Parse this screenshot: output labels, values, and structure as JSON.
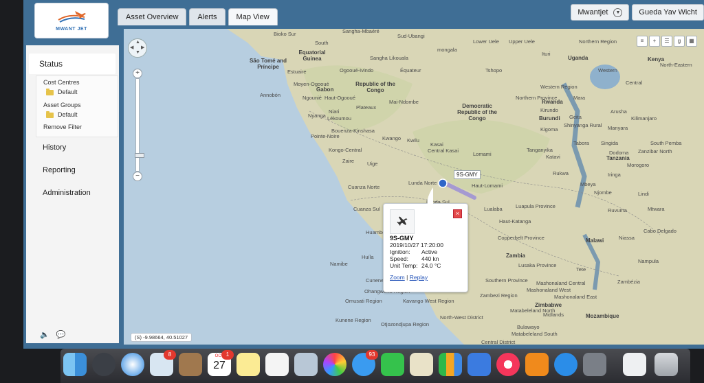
{
  "brand": {
    "logo_text": "MWANT JET"
  },
  "tabs": [
    {
      "label": "Asset Overview"
    },
    {
      "label": "Alerts"
    },
    {
      "label": "Map View"
    }
  ],
  "header": {
    "account_label": "Mwantjet",
    "user_label": "Gueda Yav Wicht"
  },
  "sidebar": {
    "status": "Status",
    "cost_centres": "Cost Centres",
    "default_1": "Default",
    "asset_groups": "Asset Groups",
    "default_2": "Default",
    "remove_filter": "Remove Filter",
    "history": "History",
    "reporting": "Reporting",
    "administration": "Administration"
  },
  "map": {
    "coords": "(S) -9.98664, 40.51027",
    "vehicle_label": "9S-GMY",
    "places": [
      "Bioko Sur",
      "Sangha-Mbaéré",
      "Sud-Ubangi",
      "Lower Uele",
      "Upper Uele",
      "Northern Region",
      "South",
      "Equatorial Guinea",
      "São Tomé and Príncipe",
      "Estuaire",
      "Sangha",
      "Likouala",
      "mongala",
      "Tshopo",
      "Ituri",
      "Uganda",
      "Kenya",
      "North-Eastern",
      "Western",
      "Moyen-Ogooué",
      "Gabon",
      "Ogooué-Ivindo",
      "Équateur",
      "Republic of the Congo",
      "Central",
      "Annobón",
      "Ngounié",
      "Haut-Ogooué",
      "Mai-Ndombe",
      "Niari",
      "Plateaux",
      "Nyanga",
      "Lékoumou",
      "Democratic Republic of the Congo",
      "Western Region",
      "Northern Province",
      "Rwanda",
      "Mara",
      "Arusha",
      "Kilimanjaro",
      "Manyara",
      "Kirundo",
      "Burundi",
      "Geita",
      "Shinyanga Rural",
      "Kigoma",
      "Bouenza-Kinshasa",
      "Pointe-Noire",
      "Kwango",
      "Kwilu",
      "Kasai",
      "Central Kasai",
      "Lomami",
      "Tanganyika",
      "Katavi",
      "Tabora",
      "Singida",
      "Dodoma",
      "Tanzania",
      "Zanzibar North",
      "South Pemba",
      "Morogoro",
      "Kongo-Central",
      "Zaire",
      "Uige",
      "Rukwa",
      "Mbeya",
      "Iringa",
      "Njombe",
      "Lindi",
      "Cuanza Norte",
      "Lunda Norte",
      "Haut-Lomami",
      "Lualaba",
      "Luapula Province",
      "Ruvuma",
      "Mtwara",
      "Cuanza Sul",
      "Lunda Sul",
      "Haut-Katanga",
      "Cabo Delgado",
      "Huambo",
      "Copperbelt Province",
      "Malawi",
      "Niassa",
      "Huíla",
      "Namibe",
      "Zambia",
      "Lusaka Province",
      "Tete",
      "Nampula",
      "Cunene",
      "Southern Province",
      "Mashonaland Central",
      "Mashonaland West",
      "Mashonaland East",
      "Zambézia",
      "Ohangwena Region",
      "Omusati Region",
      "Kavango West Region",
      "Zambezi Region",
      "Zimbabwe",
      "Matabeleland North",
      "Midlands",
      "Kunene Region",
      "Otjozondjupa Region",
      "North-West District",
      "Bulawayo",
      "Matabeleland South",
      "Mozambique",
      "Central District"
    ]
  },
  "popup": {
    "title": "9S-GMY",
    "datetime": "2019/10/27 17:20:00",
    "rows": [
      {
        "key": "Ignition:",
        "value": "Active"
      },
      {
        "key": "Speed:",
        "value": "440 kn"
      },
      {
        "key": "Unit Temp:",
        "value": "24.0 °C"
      }
    ],
    "zoom_link": "Zoom",
    "separator": "|",
    "replay_link": "Replay"
  },
  "dock": {
    "badge_mail": "8",
    "calendar_month": "OCT",
    "calendar_day": "27",
    "badge_calendar": "1",
    "badge_messages": "93"
  },
  "colors": {
    "app_header": "#3f6e95",
    "ocean": "#b7cee0",
    "land": "#d9d6b6",
    "track": "#9b8fd6",
    "link": "#2554b8"
  }
}
